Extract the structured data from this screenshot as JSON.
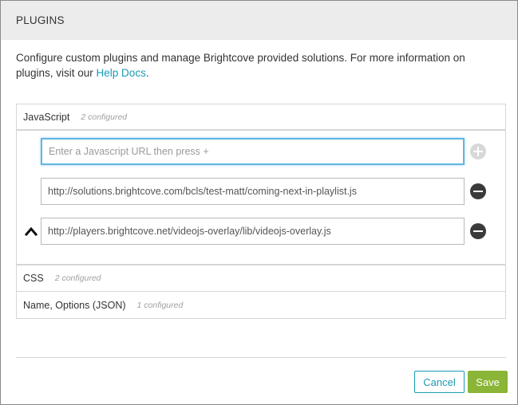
{
  "dialog": {
    "title": "PLUGINS",
    "intro_text": "Configure custom plugins and manage Brightcove provided solutions. For more information on plugins, visit our ",
    "intro_link": "Help Docs",
    "intro_end": "."
  },
  "sections": {
    "javascript": {
      "label": "JavaScript",
      "count": "2 configured",
      "new_url_placeholder": "Enter a Javascript URL then press +",
      "urls": [
        "http://solutions.brightcove.com/bcls/test-matt/coming-next-in-playlist.js",
        "http://players.brightcove.net/videojs-overlay/lib/videojs-overlay.js"
      ]
    },
    "css": {
      "label": "CSS",
      "count": "2 configured"
    },
    "options": {
      "label": "Name, Options (JSON)",
      "count": "1 configured"
    }
  },
  "footer": {
    "cancel_label": "Cancel",
    "save_label": "Save"
  },
  "colors": {
    "accent": "#1a9bb3",
    "save": "#8ab536",
    "focus_border": "#5fb6e0"
  },
  "icons": {
    "add": "plus-circle-icon",
    "remove": "minus-circle-icon",
    "move_up": "chevron-up-icon"
  }
}
